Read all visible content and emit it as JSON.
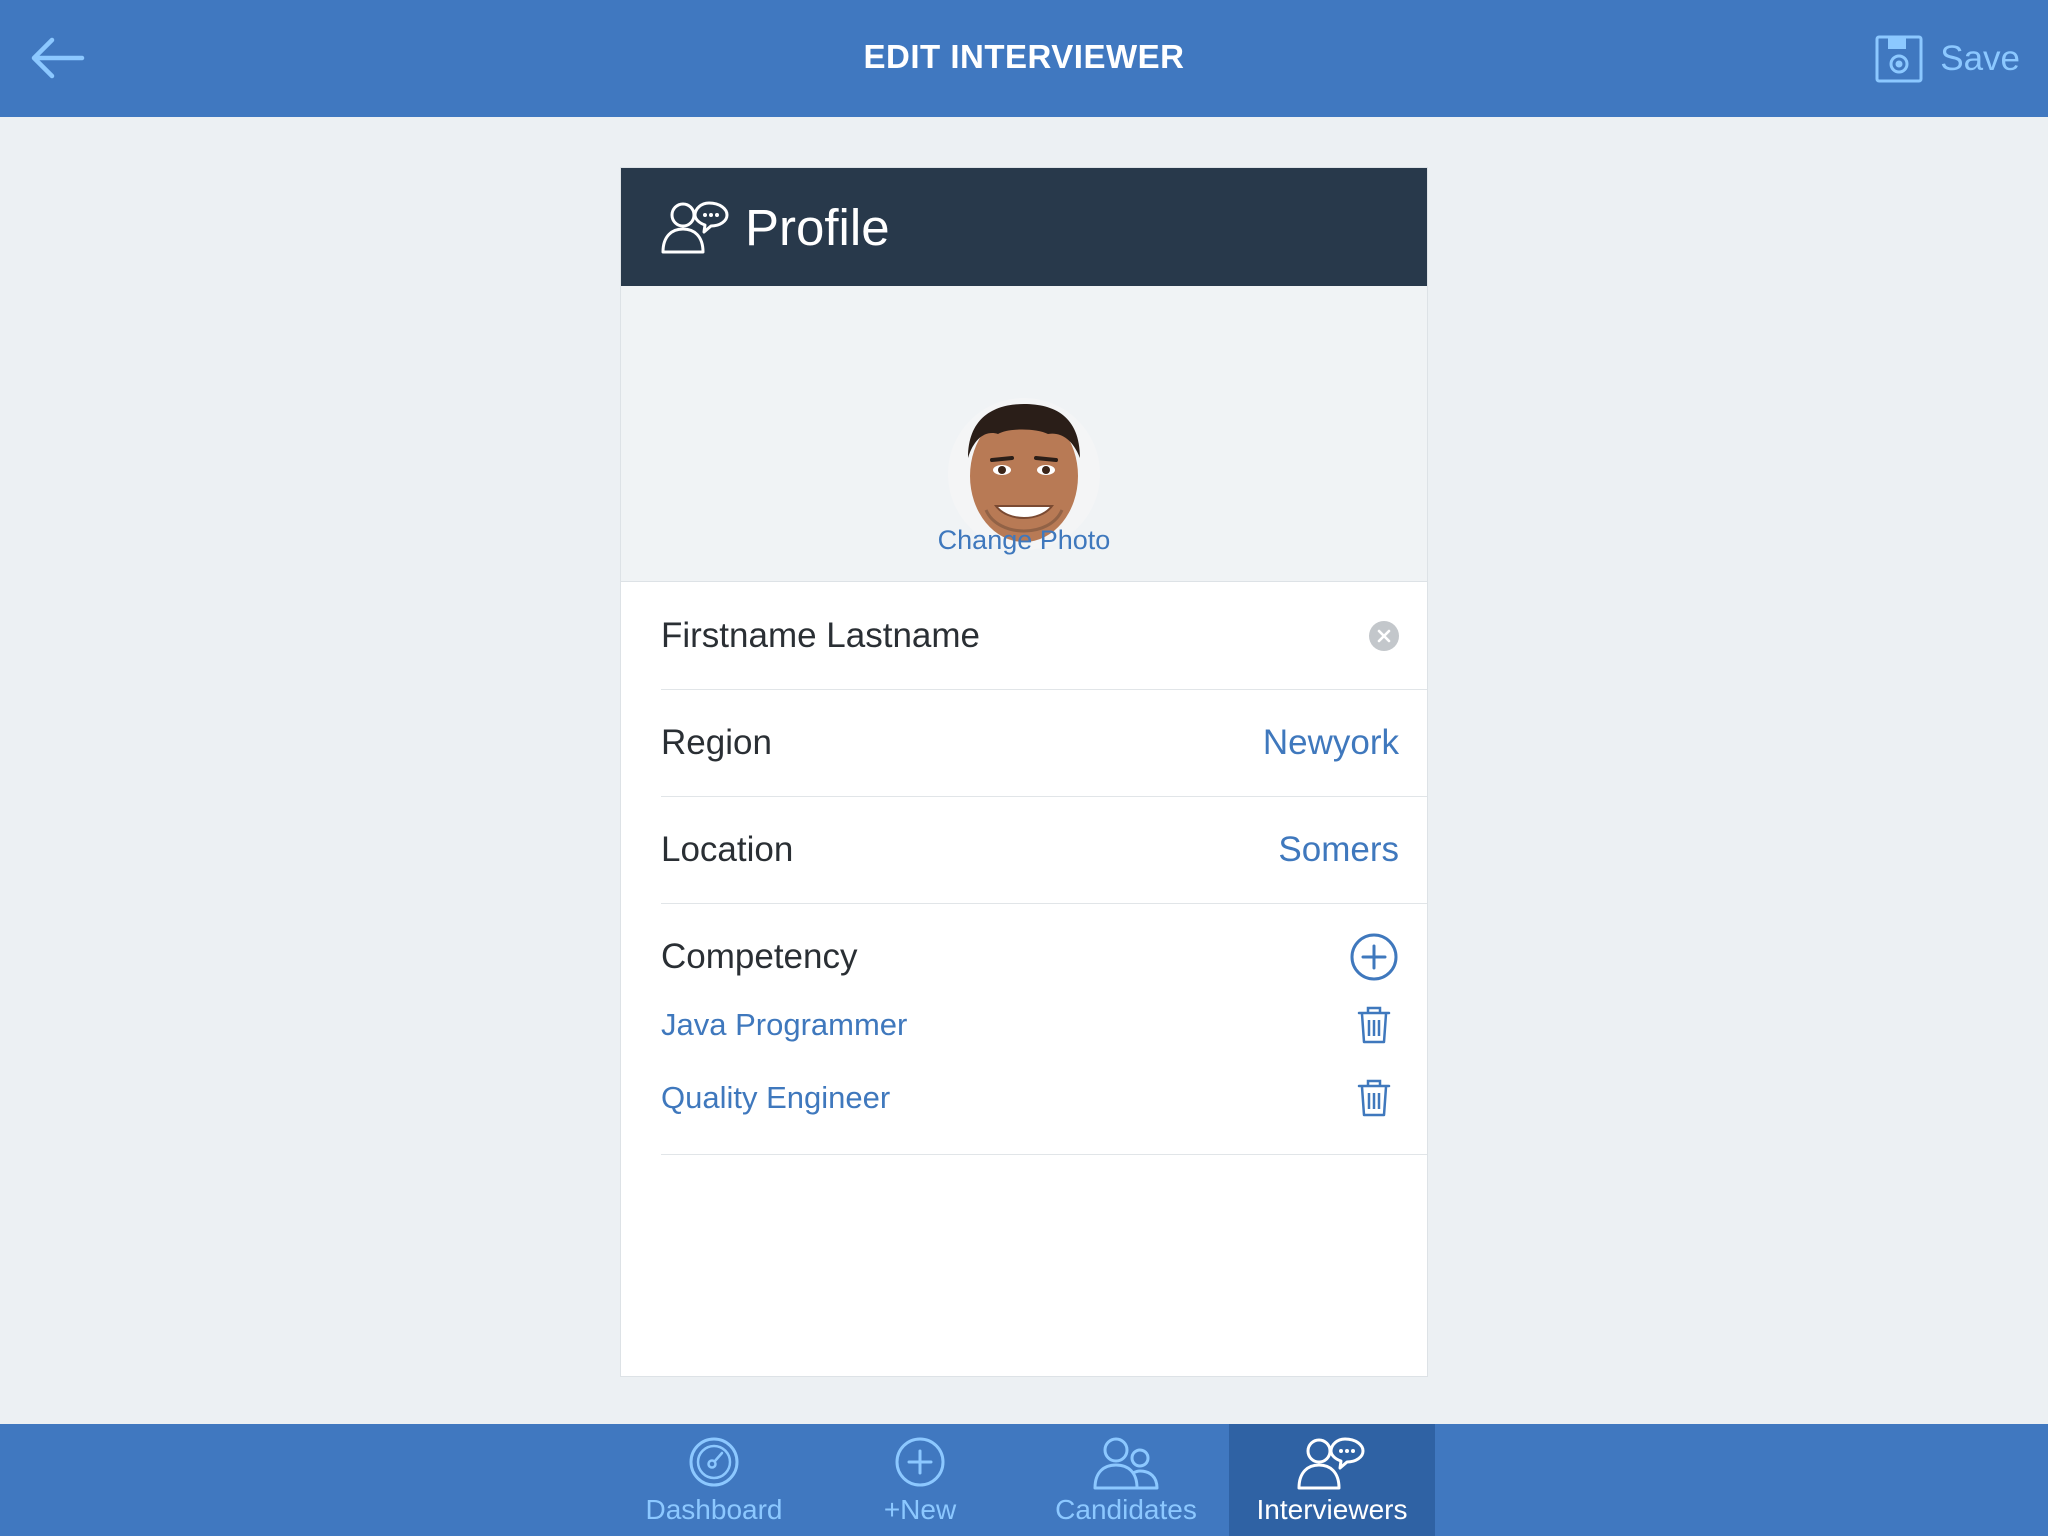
{
  "header": {
    "title": "EDIT INTERVIEWER",
    "back_icon": "back-arrow-icon",
    "save_label": "Save",
    "save_icon": "floppy-disk-icon"
  },
  "profile": {
    "title": "Profile",
    "icon": "interviewers-icon",
    "change_photo_label": "Change Photo",
    "name_value": "Firstname Lastname",
    "fields": [
      {
        "label": "Region",
        "value": "Newyork"
      },
      {
        "label": "Location",
        "value": "Somers"
      }
    ],
    "competency": {
      "label": "Competency",
      "items": [
        "Java Programmer",
        "Quality Engineer"
      ]
    }
  },
  "tabs": [
    {
      "label": "Dashboard",
      "icon": "dashboard-gauge-icon",
      "active": false
    },
    {
      "label": "+New",
      "icon": "add-circle-icon",
      "active": false
    },
    {
      "label": "Candidates",
      "icon": "candidates-icon",
      "active": false
    },
    {
      "label": "Interviewers",
      "icon": "interviewers-icon",
      "active": true
    }
  ],
  "colors": {
    "bar_blue": "#4078c0",
    "active_tab": "#2f62a4",
    "card_header": "#28394b",
    "link_blue": "#3f78bd",
    "light_accent": "#8cc8ff",
    "page_bg": "#ecf0f3"
  }
}
